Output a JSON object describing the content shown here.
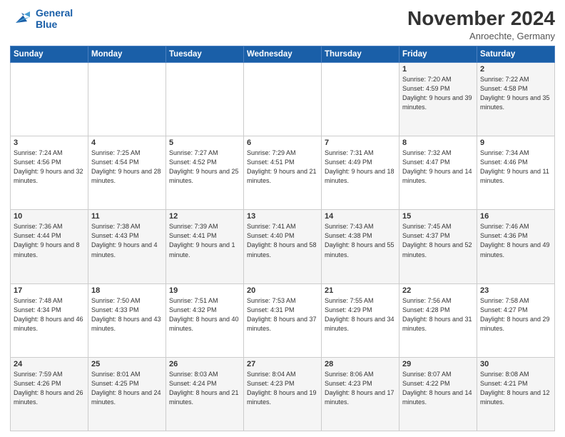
{
  "header": {
    "logo_line1": "General",
    "logo_line2": "Blue",
    "month": "November 2024",
    "location": "Anroechte, Germany"
  },
  "days_of_week": [
    "Sunday",
    "Monday",
    "Tuesday",
    "Wednesday",
    "Thursday",
    "Friday",
    "Saturday"
  ],
  "weeks": [
    [
      {
        "day": "",
        "info": ""
      },
      {
        "day": "",
        "info": ""
      },
      {
        "day": "",
        "info": ""
      },
      {
        "day": "",
        "info": ""
      },
      {
        "day": "",
        "info": ""
      },
      {
        "day": "1",
        "info": "Sunrise: 7:20 AM\nSunset: 4:59 PM\nDaylight: 9 hours\nand 39 minutes."
      },
      {
        "day": "2",
        "info": "Sunrise: 7:22 AM\nSunset: 4:58 PM\nDaylight: 9 hours\nand 35 minutes."
      }
    ],
    [
      {
        "day": "3",
        "info": "Sunrise: 7:24 AM\nSunset: 4:56 PM\nDaylight: 9 hours\nand 32 minutes."
      },
      {
        "day": "4",
        "info": "Sunrise: 7:25 AM\nSunset: 4:54 PM\nDaylight: 9 hours\nand 28 minutes."
      },
      {
        "day": "5",
        "info": "Sunrise: 7:27 AM\nSunset: 4:52 PM\nDaylight: 9 hours\nand 25 minutes."
      },
      {
        "day": "6",
        "info": "Sunrise: 7:29 AM\nSunset: 4:51 PM\nDaylight: 9 hours\nand 21 minutes."
      },
      {
        "day": "7",
        "info": "Sunrise: 7:31 AM\nSunset: 4:49 PM\nDaylight: 9 hours\nand 18 minutes."
      },
      {
        "day": "8",
        "info": "Sunrise: 7:32 AM\nSunset: 4:47 PM\nDaylight: 9 hours\nand 14 minutes."
      },
      {
        "day": "9",
        "info": "Sunrise: 7:34 AM\nSunset: 4:46 PM\nDaylight: 9 hours\nand 11 minutes."
      }
    ],
    [
      {
        "day": "10",
        "info": "Sunrise: 7:36 AM\nSunset: 4:44 PM\nDaylight: 9 hours\nand 8 minutes."
      },
      {
        "day": "11",
        "info": "Sunrise: 7:38 AM\nSunset: 4:43 PM\nDaylight: 9 hours\nand 4 minutes."
      },
      {
        "day": "12",
        "info": "Sunrise: 7:39 AM\nSunset: 4:41 PM\nDaylight: 9 hours\nand 1 minute."
      },
      {
        "day": "13",
        "info": "Sunrise: 7:41 AM\nSunset: 4:40 PM\nDaylight: 8 hours\nand 58 minutes."
      },
      {
        "day": "14",
        "info": "Sunrise: 7:43 AM\nSunset: 4:38 PM\nDaylight: 8 hours\nand 55 minutes."
      },
      {
        "day": "15",
        "info": "Sunrise: 7:45 AM\nSunset: 4:37 PM\nDaylight: 8 hours\nand 52 minutes."
      },
      {
        "day": "16",
        "info": "Sunrise: 7:46 AM\nSunset: 4:36 PM\nDaylight: 8 hours\nand 49 minutes."
      }
    ],
    [
      {
        "day": "17",
        "info": "Sunrise: 7:48 AM\nSunset: 4:34 PM\nDaylight: 8 hours\nand 46 minutes."
      },
      {
        "day": "18",
        "info": "Sunrise: 7:50 AM\nSunset: 4:33 PM\nDaylight: 8 hours\nand 43 minutes."
      },
      {
        "day": "19",
        "info": "Sunrise: 7:51 AM\nSunset: 4:32 PM\nDaylight: 8 hours\nand 40 minutes."
      },
      {
        "day": "20",
        "info": "Sunrise: 7:53 AM\nSunset: 4:31 PM\nDaylight: 8 hours\nand 37 minutes."
      },
      {
        "day": "21",
        "info": "Sunrise: 7:55 AM\nSunset: 4:29 PM\nDaylight: 8 hours\nand 34 minutes."
      },
      {
        "day": "22",
        "info": "Sunrise: 7:56 AM\nSunset: 4:28 PM\nDaylight: 8 hours\nand 31 minutes."
      },
      {
        "day": "23",
        "info": "Sunrise: 7:58 AM\nSunset: 4:27 PM\nDaylight: 8 hours\nand 29 minutes."
      }
    ],
    [
      {
        "day": "24",
        "info": "Sunrise: 7:59 AM\nSunset: 4:26 PM\nDaylight: 8 hours\nand 26 minutes."
      },
      {
        "day": "25",
        "info": "Sunrise: 8:01 AM\nSunset: 4:25 PM\nDaylight: 8 hours\nand 24 minutes."
      },
      {
        "day": "26",
        "info": "Sunrise: 8:03 AM\nSunset: 4:24 PM\nDaylight: 8 hours\nand 21 minutes."
      },
      {
        "day": "27",
        "info": "Sunrise: 8:04 AM\nSunset: 4:23 PM\nDaylight: 8 hours\nand 19 minutes."
      },
      {
        "day": "28",
        "info": "Sunrise: 8:06 AM\nSunset: 4:23 PM\nDaylight: 8 hours\nand 17 minutes."
      },
      {
        "day": "29",
        "info": "Sunrise: 8:07 AM\nSunset: 4:22 PM\nDaylight: 8 hours\nand 14 minutes."
      },
      {
        "day": "30",
        "info": "Sunrise: 8:08 AM\nSunset: 4:21 PM\nDaylight: 8 hours\nand 12 minutes."
      }
    ]
  ]
}
